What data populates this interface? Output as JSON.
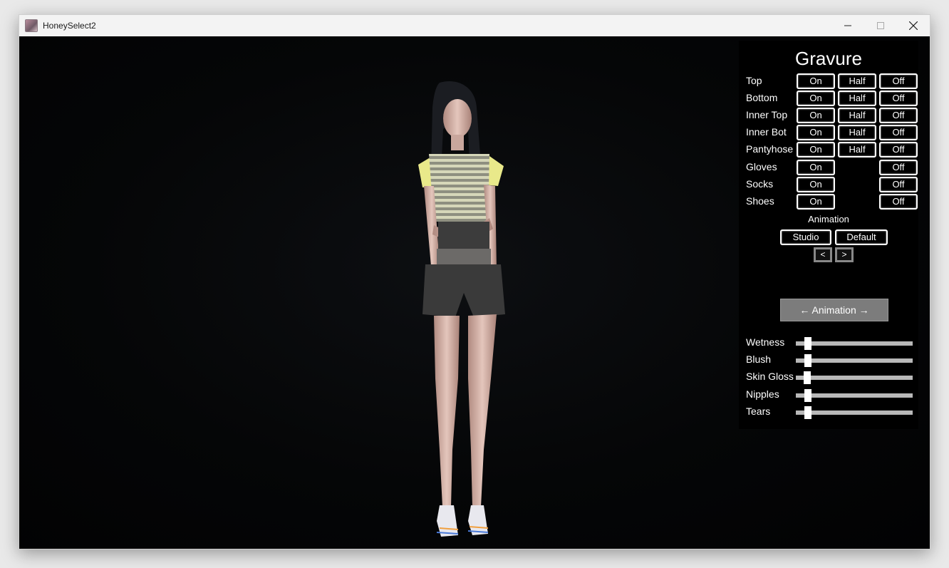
{
  "window": {
    "title": "HoneySelect2"
  },
  "panel": {
    "title": "Gravure",
    "rows": [
      {
        "label": "Top",
        "on": "On",
        "half": "Half",
        "off": "Off"
      },
      {
        "label": "Bottom",
        "on": "On",
        "half": "Half",
        "off": "Off"
      },
      {
        "label": "Inner Top",
        "on": "On",
        "half": "Half",
        "off": "Off"
      },
      {
        "label": "Inner Bot",
        "on": "On",
        "half": "Half",
        "off": "Off"
      },
      {
        "label": "Pantyhose",
        "on": "On",
        "half": "Half",
        "off": "Off"
      },
      {
        "label": "Gloves",
        "on": "On",
        "off": "Off"
      },
      {
        "label": "Socks",
        "on": "On",
        "off": "Off"
      },
      {
        "label": "Shoes",
        "on": "On",
        "off": "Off"
      }
    ],
    "animation_label": "Animation",
    "studio_button": "Studio",
    "default_button": "Default",
    "prev_button": "<",
    "next_button": ">",
    "animation_toggle": "← Animation →",
    "sliders": [
      {
        "label": "Wetness",
        "value": 0.08
      },
      {
        "label": "Blush",
        "value": 0.08
      },
      {
        "label": "Skin Gloss",
        "value": 0.07
      },
      {
        "label": "Nipples",
        "value": 0.08
      },
      {
        "label": "Tears",
        "value": 0.08
      }
    ]
  },
  "colors": {
    "panel_bg": "#000000",
    "button_border": "#ffffff",
    "toggle_bg": "#7c7c7c",
    "slider_track": "#b8b8b8"
  }
}
